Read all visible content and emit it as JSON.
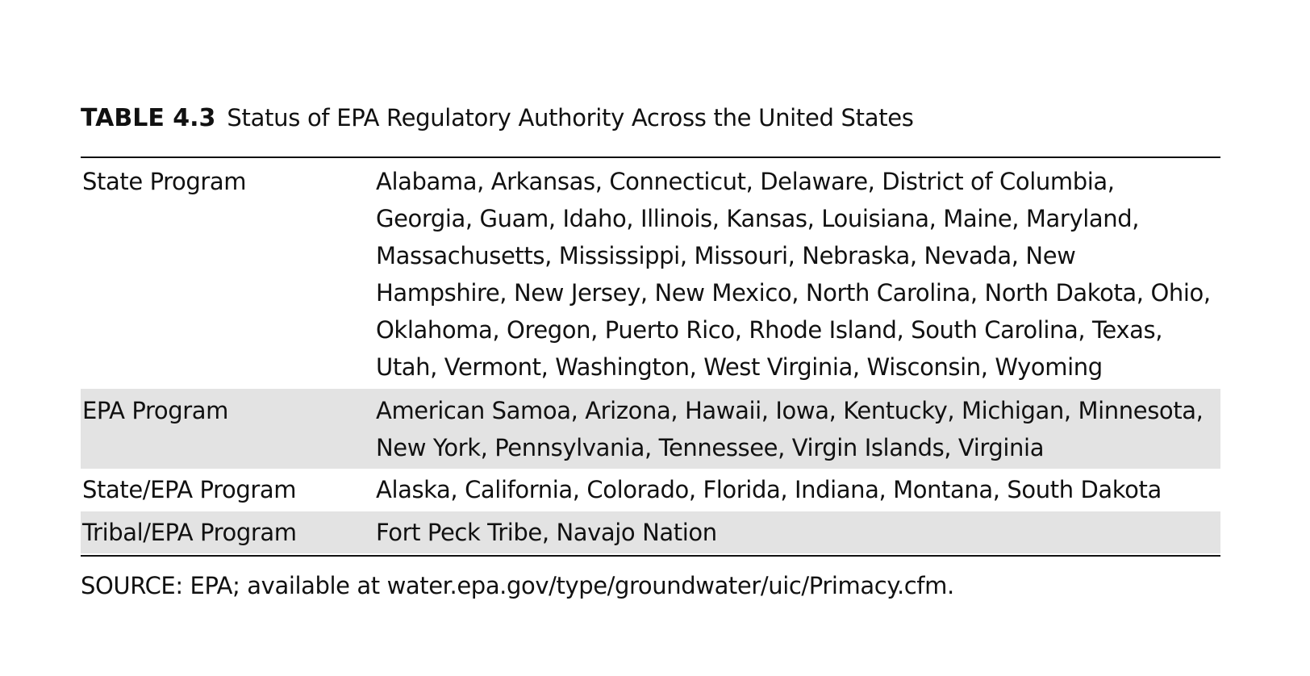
{
  "caption": {
    "table_number": "TABLE 4.3",
    "title": "Status of EPA Regulatory Authority Across the United States"
  },
  "rows": [
    {
      "label": "State Program",
      "states": "Alabama, Arkansas, Connecticut, Delaware, District of Columbia, Georgia, Guam, Idaho, Illinois, Kansas, Louisiana, Maine, Maryland, Massachusetts, Mississippi, Missouri, Nebraska, Nevada, New Hampshire, New Jersey, New Mexico, North Carolina, North Dakota, Ohio, Oklahoma, Oregon, Puerto Rico, Rhode Island, South Carolina, Texas, Utah, Vermont, Washington, West Virginia, Wisconsin, Wyoming"
    },
    {
      "label": "EPA Program",
      "states": "American Samoa, Arizona, Hawaii, Iowa, Kentucky, Michigan, Minnesota, New York, Pennsylvania, Tennessee, Virgin Islands, Virginia"
    },
    {
      "label": "State/EPA Program",
      "states": "Alaska, California, Colorado, Florida, Indiana, Montana, South Dakota"
    },
    {
      "label": "Tribal/EPA Program",
      "states": "Fort Peck Tribe, Navajo Nation"
    }
  ],
  "source": "SOURCE: EPA; available at water.epa.gov/type/groundwater/uic/Primacy.cfm.",
  "colors": {
    "row_shading": "#e3e3e3",
    "text": "#111111",
    "rule": "#111111"
  }
}
